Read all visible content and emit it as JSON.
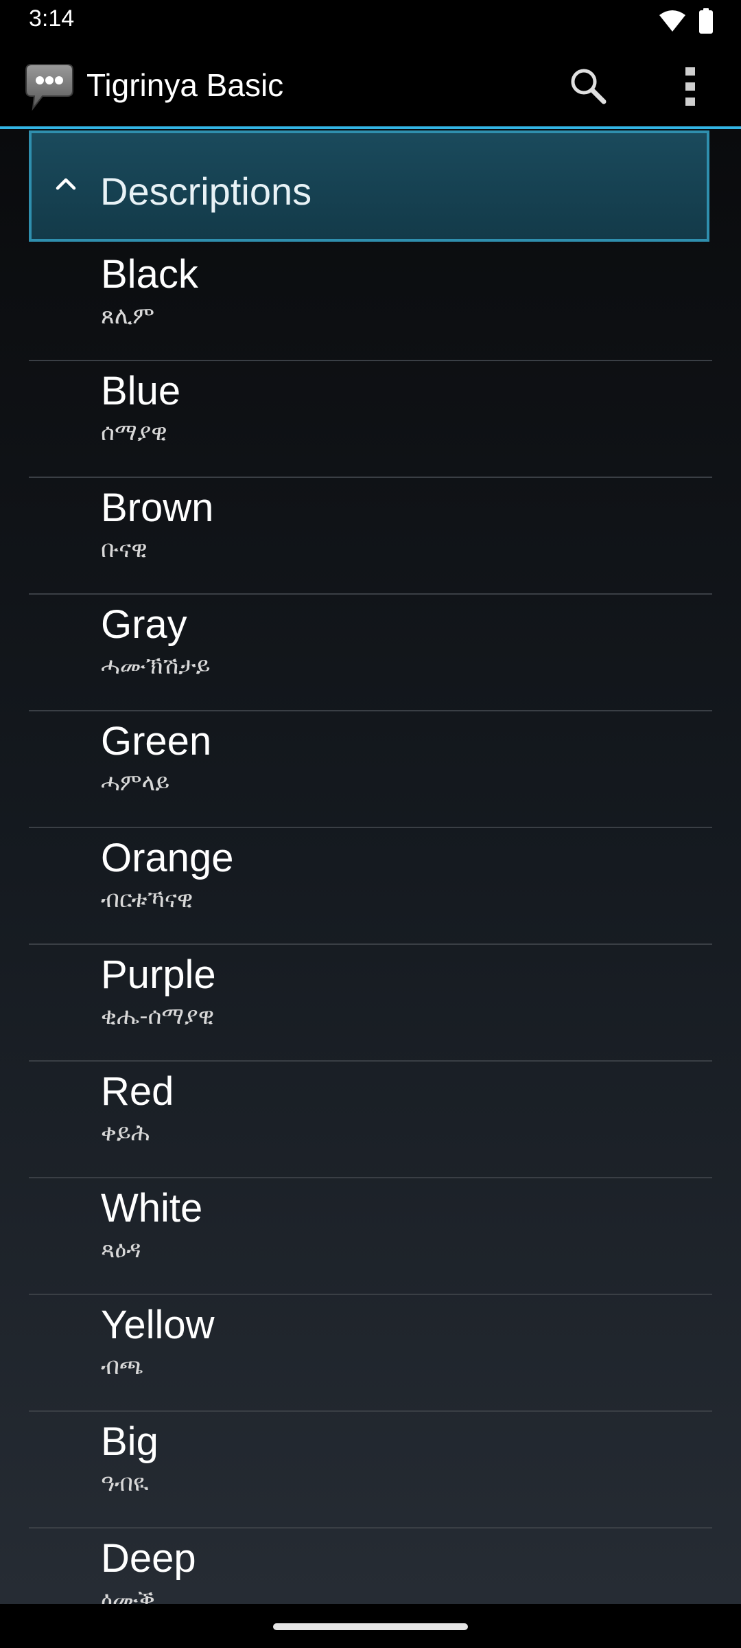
{
  "status_bar": {
    "time": "3:14",
    "icons": [
      "wifi-icon",
      "battery-icon"
    ]
  },
  "app_bar": {
    "title": "Tigrinya Basic",
    "logo_icon": "chat-bubble-icon",
    "search_icon": "search-icon",
    "menu_icon": "overflow-menu-icon",
    "accent_color": "#33b5e5"
  },
  "group": {
    "title": "Descriptions",
    "expanded": true,
    "icon": "chevron-up-icon"
  },
  "words": [
    {
      "english": "Black",
      "tigrinya": "ጸሊም"
    },
    {
      "english": "Blue",
      "tigrinya": "ሰማያዊ"
    },
    {
      "english": "Brown",
      "tigrinya": "ቡናዊ"
    },
    {
      "english": "Gray",
      "tigrinya": "ሓሙኽሽታይ"
    },
    {
      "english": "Green",
      "tigrinya": "ሓምላይ"
    },
    {
      "english": "Orange",
      "tigrinya": "ብርቱኻናዊ"
    },
    {
      "english": "Purple",
      "tigrinya": "ቂሔ-ሰማያዊ"
    },
    {
      "english": "Red",
      "tigrinya": "ቀይሕ"
    },
    {
      "english": "White",
      "tigrinya": "ጻዕዳ"
    },
    {
      "english": "Yellow",
      "tigrinya": "ብጫ"
    },
    {
      "english": "Big",
      "tigrinya": "ዓብዪ"
    },
    {
      "english": "Deep",
      "tigrinya": "ዕሙቕ"
    }
  ]
}
